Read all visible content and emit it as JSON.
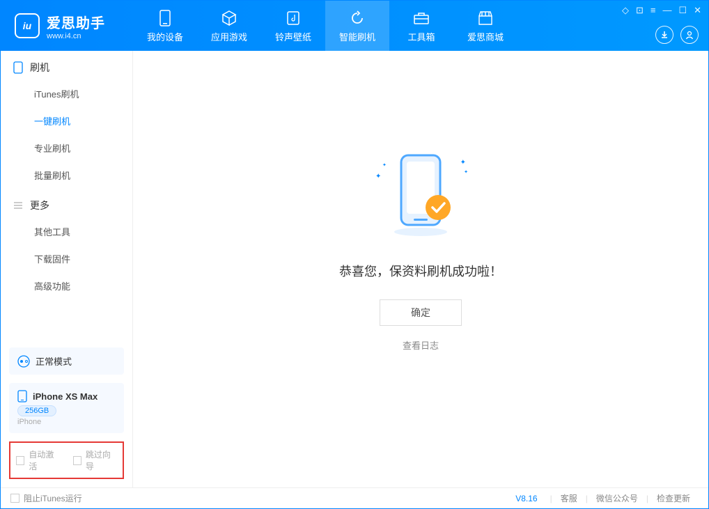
{
  "app": {
    "title": "爱思助手",
    "subtitle": "www.i4.cn"
  },
  "nav": [
    {
      "label": "我的设备",
      "icon": "device"
    },
    {
      "label": "应用游戏",
      "icon": "cube"
    },
    {
      "label": "铃声壁纸",
      "icon": "note"
    },
    {
      "label": "智能刷机",
      "icon": "sync",
      "active": true
    },
    {
      "label": "工具箱",
      "icon": "toolbox"
    },
    {
      "label": "爱思商城",
      "icon": "store"
    }
  ],
  "windowControls": [
    "◇",
    "⊡",
    "≡",
    "—",
    "☐",
    "✕"
  ],
  "sidebar": {
    "section1": {
      "title": "刷机",
      "items": [
        "iTunes刷机",
        "一键刷机",
        "专业刷机",
        "批量刷机"
      ],
      "activeIndex": 1
    },
    "section2": {
      "title": "更多",
      "items": [
        "其他工具",
        "下载固件",
        "高级功能"
      ]
    }
  },
  "mode": {
    "label": "正常模式"
  },
  "device": {
    "name": "iPhone XS Max",
    "storage": "256GB",
    "type": "iPhone"
  },
  "options": {
    "auto_activate": "自动激活",
    "skip_guide": "跳过向导"
  },
  "main": {
    "title": "恭喜您，保资料刷机成功啦！",
    "confirm": "确定",
    "view_log": "查看日志"
  },
  "footer": {
    "block_itunes": "阻止iTunes运行",
    "version": "V8.16",
    "links": [
      "客服",
      "微信公众号",
      "检查更新"
    ]
  }
}
